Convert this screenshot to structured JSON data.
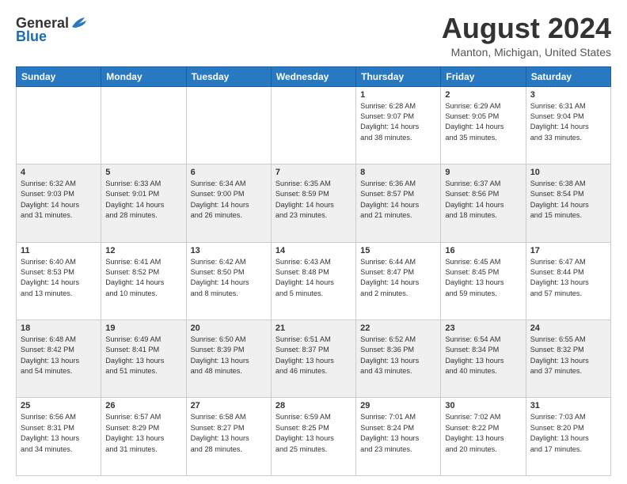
{
  "title": "August 2024",
  "location": "Manton, Michigan, United States",
  "logo": {
    "general": "General",
    "blue": "Blue"
  },
  "days_of_week": [
    "Sunday",
    "Monday",
    "Tuesday",
    "Wednesday",
    "Thursday",
    "Friday",
    "Saturday"
  ],
  "weeks": [
    [
      {
        "day": "",
        "info": ""
      },
      {
        "day": "",
        "info": ""
      },
      {
        "day": "",
        "info": ""
      },
      {
        "day": "",
        "info": ""
      },
      {
        "day": "1",
        "info": "Sunrise: 6:28 AM\nSunset: 9:07 PM\nDaylight: 14 hours\nand 38 minutes."
      },
      {
        "day": "2",
        "info": "Sunrise: 6:29 AM\nSunset: 9:05 PM\nDaylight: 14 hours\nand 35 minutes."
      },
      {
        "day": "3",
        "info": "Sunrise: 6:31 AM\nSunset: 9:04 PM\nDaylight: 14 hours\nand 33 minutes."
      }
    ],
    [
      {
        "day": "4",
        "info": "Sunrise: 6:32 AM\nSunset: 9:03 PM\nDaylight: 14 hours\nand 31 minutes."
      },
      {
        "day": "5",
        "info": "Sunrise: 6:33 AM\nSunset: 9:01 PM\nDaylight: 14 hours\nand 28 minutes."
      },
      {
        "day": "6",
        "info": "Sunrise: 6:34 AM\nSunset: 9:00 PM\nDaylight: 14 hours\nand 26 minutes."
      },
      {
        "day": "7",
        "info": "Sunrise: 6:35 AM\nSunset: 8:59 PM\nDaylight: 14 hours\nand 23 minutes."
      },
      {
        "day": "8",
        "info": "Sunrise: 6:36 AM\nSunset: 8:57 PM\nDaylight: 14 hours\nand 21 minutes."
      },
      {
        "day": "9",
        "info": "Sunrise: 6:37 AM\nSunset: 8:56 PM\nDaylight: 14 hours\nand 18 minutes."
      },
      {
        "day": "10",
        "info": "Sunrise: 6:38 AM\nSunset: 8:54 PM\nDaylight: 14 hours\nand 15 minutes."
      }
    ],
    [
      {
        "day": "11",
        "info": "Sunrise: 6:40 AM\nSunset: 8:53 PM\nDaylight: 14 hours\nand 13 minutes."
      },
      {
        "day": "12",
        "info": "Sunrise: 6:41 AM\nSunset: 8:52 PM\nDaylight: 14 hours\nand 10 minutes."
      },
      {
        "day": "13",
        "info": "Sunrise: 6:42 AM\nSunset: 8:50 PM\nDaylight: 14 hours\nand 8 minutes."
      },
      {
        "day": "14",
        "info": "Sunrise: 6:43 AM\nSunset: 8:48 PM\nDaylight: 14 hours\nand 5 minutes."
      },
      {
        "day": "15",
        "info": "Sunrise: 6:44 AM\nSunset: 8:47 PM\nDaylight: 14 hours\nand 2 minutes."
      },
      {
        "day": "16",
        "info": "Sunrise: 6:45 AM\nSunset: 8:45 PM\nDaylight: 13 hours\nand 59 minutes."
      },
      {
        "day": "17",
        "info": "Sunrise: 6:47 AM\nSunset: 8:44 PM\nDaylight: 13 hours\nand 57 minutes."
      }
    ],
    [
      {
        "day": "18",
        "info": "Sunrise: 6:48 AM\nSunset: 8:42 PM\nDaylight: 13 hours\nand 54 minutes."
      },
      {
        "day": "19",
        "info": "Sunrise: 6:49 AM\nSunset: 8:41 PM\nDaylight: 13 hours\nand 51 minutes."
      },
      {
        "day": "20",
        "info": "Sunrise: 6:50 AM\nSunset: 8:39 PM\nDaylight: 13 hours\nand 48 minutes."
      },
      {
        "day": "21",
        "info": "Sunrise: 6:51 AM\nSunset: 8:37 PM\nDaylight: 13 hours\nand 46 minutes."
      },
      {
        "day": "22",
        "info": "Sunrise: 6:52 AM\nSunset: 8:36 PM\nDaylight: 13 hours\nand 43 minutes."
      },
      {
        "day": "23",
        "info": "Sunrise: 6:54 AM\nSunset: 8:34 PM\nDaylight: 13 hours\nand 40 minutes."
      },
      {
        "day": "24",
        "info": "Sunrise: 6:55 AM\nSunset: 8:32 PM\nDaylight: 13 hours\nand 37 minutes."
      }
    ],
    [
      {
        "day": "25",
        "info": "Sunrise: 6:56 AM\nSunset: 8:31 PM\nDaylight: 13 hours\nand 34 minutes."
      },
      {
        "day": "26",
        "info": "Sunrise: 6:57 AM\nSunset: 8:29 PM\nDaylight: 13 hours\nand 31 minutes."
      },
      {
        "day": "27",
        "info": "Sunrise: 6:58 AM\nSunset: 8:27 PM\nDaylight: 13 hours\nand 28 minutes."
      },
      {
        "day": "28",
        "info": "Sunrise: 6:59 AM\nSunset: 8:25 PM\nDaylight: 13 hours\nand 25 minutes."
      },
      {
        "day": "29",
        "info": "Sunrise: 7:01 AM\nSunset: 8:24 PM\nDaylight: 13 hours\nand 23 minutes."
      },
      {
        "day": "30",
        "info": "Sunrise: 7:02 AM\nSunset: 8:22 PM\nDaylight: 13 hours\nand 20 minutes."
      },
      {
        "day": "31",
        "info": "Sunrise: 7:03 AM\nSunset: 8:20 PM\nDaylight: 13 hours\nand 17 minutes."
      }
    ]
  ]
}
